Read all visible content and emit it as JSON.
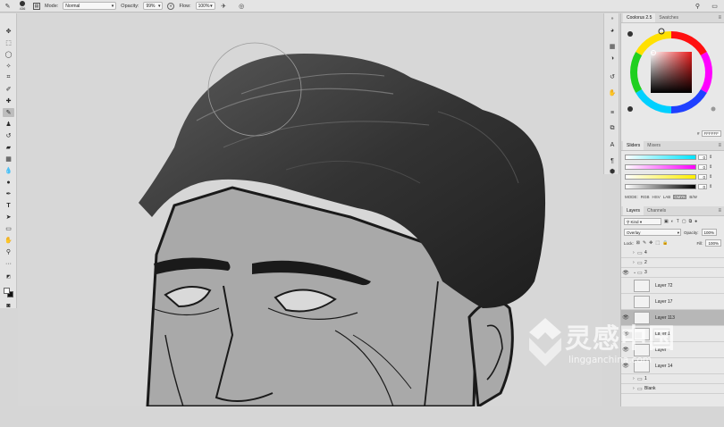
{
  "options_bar": {
    "brush_size": "436",
    "mode_label": "Mode:",
    "mode_value": "Normal",
    "opacity_label": "Opacity:",
    "opacity_value": "99%",
    "flow_label": "Flow:",
    "flow_value": "100%"
  },
  "color_panel": {
    "tabs": [
      "Coolorus 2.5",
      "Swatches"
    ],
    "hex_value": "FFFFFF"
  },
  "sliders_panel": {
    "tabs": [
      "Sliders",
      "Mixers"
    ],
    "rows": [
      {
        "name": "cyan",
        "value": "0"
      },
      {
        "name": "magenta",
        "value": "0"
      },
      {
        "name": "yellow",
        "value": "0"
      },
      {
        "name": "black",
        "value": "0"
      }
    ],
    "modes": [
      "MODE:",
      "RGB",
      "HSV",
      "LAB",
      "CMYK",
      "B/W"
    ],
    "active_mode": "CMYK"
  },
  "layers_panel": {
    "tabs": [
      "Layers",
      "Channels"
    ],
    "filter_kind": "Kind",
    "blend_mode": "Overlay",
    "opacity_label": "Opacity:",
    "opacity_value": "100%",
    "lock_label": "Lock:",
    "fill_label": "Fill:",
    "fill_value": "100%",
    "layers": [
      {
        "name": "4",
        "type": "group",
        "visible": false,
        "expanded": false
      },
      {
        "name": "2",
        "type": "group",
        "visible": false,
        "expanded": false
      },
      {
        "name": "3",
        "type": "group",
        "visible": true,
        "expanded": true
      },
      {
        "name": "Layer 72",
        "type": "layer",
        "visible": false,
        "selected": false
      },
      {
        "name": "Layer 17",
        "type": "layer",
        "visible": false,
        "selected": false
      },
      {
        "name": "Layer 113",
        "type": "layer",
        "visible": true,
        "selected": true
      },
      {
        "name": "Layer 1",
        "type": "layer",
        "visible": true,
        "selected": false
      },
      {
        "name": "Layer",
        "type": "layer",
        "visible": true,
        "selected": false
      },
      {
        "name": "Layer 14",
        "type": "layer",
        "visible": true,
        "selected": false
      },
      {
        "name": "1",
        "type": "group",
        "visible": false,
        "expanded": false
      },
      {
        "name": "Blank",
        "type": "group",
        "visible": false,
        "expanded": false
      }
    ]
  },
  "watermark": {
    "chinese": "灵感中国",
    "url": "lingganchina.com"
  },
  "colors": {
    "panel_bg": "#e8e8e8",
    "canvas_bg": "#d7d7d7",
    "selected_layer": "#b7b7b7"
  }
}
